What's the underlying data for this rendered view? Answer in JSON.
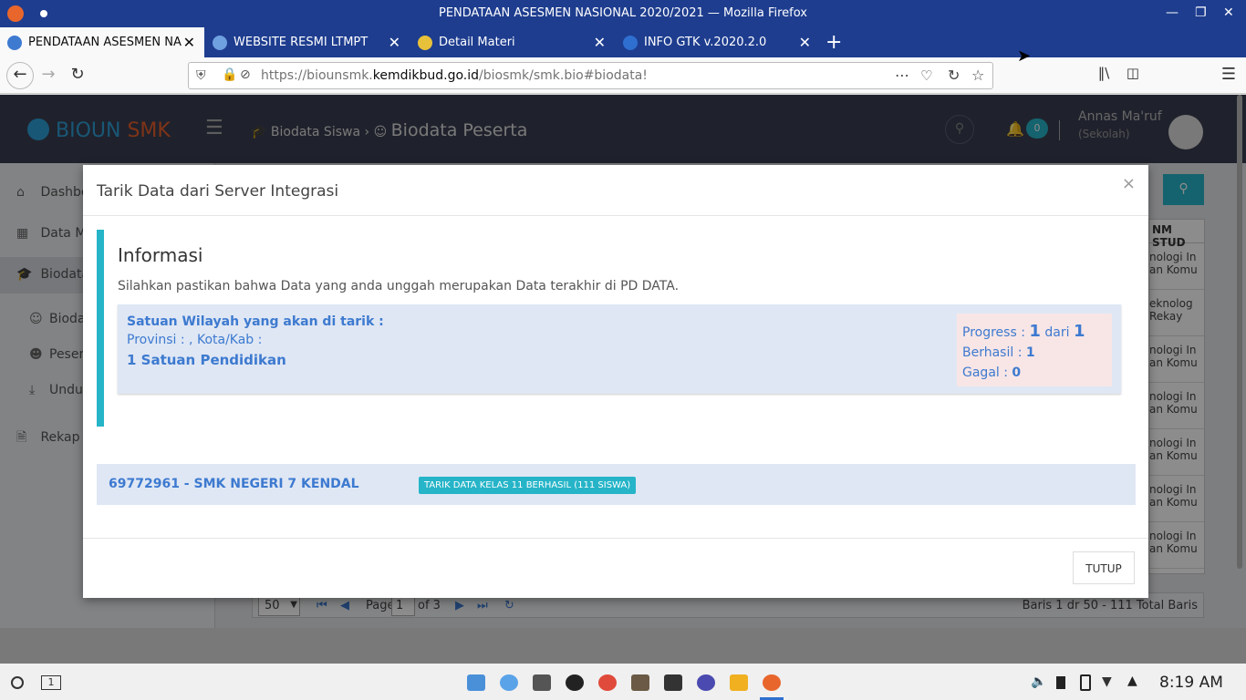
{
  "window": {
    "title": "PENDATAAN ASESMEN NASIONAL 2020/2021 — Mozilla Firefox"
  },
  "tabs": [
    {
      "label": "PENDATAAN ASESMEN NA",
      "active": true
    },
    {
      "label": "WEBSITE RESMI LTMPT",
      "active": false
    },
    {
      "label": "Detail Materi",
      "active": false
    },
    {
      "label": "INFO GTK v.2020.2.0",
      "active": false
    }
  ],
  "nav": {
    "url_prefix": "https://biounsmk.",
    "url_domain": "kemdikbud.go.id",
    "url_path": "/biosmk/smk.bio#biodata!"
  },
  "app": {
    "logo_bioun": "BIOUN",
    "logo_smk": "SMK",
    "crumb_section": "Biodata Siswa",
    "crumb_page": "Biodata Peserta",
    "notif_count": "0",
    "user_name": "Annas Ma'ruf",
    "user_role": "(Sekolah)"
  },
  "sidebar": {
    "items": [
      {
        "label": "Dashbo",
        "icon": "home-icon"
      },
      {
        "label": "Data M",
        "icon": "grid-icon"
      },
      {
        "label": "Biodata",
        "icon": "graduation-cap-icon"
      },
      {
        "label": "Bioda",
        "icon": "user-icon"
      },
      {
        "label": "Peser",
        "icon": "user-outline-icon"
      },
      {
        "label": "Undu",
        "icon": "download-icon"
      },
      {
        "label": "Rekap",
        "icon": "document-icon"
      }
    ]
  },
  "table_bg": {
    "col_header": "NM STUD",
    "cells": [
      [
        "nologi In",
        "an Komu"
      ],
      [
        "eknolog",
        "Rekay"
      ],
      [
        "nologi In",
        "an Komu"
      ],
      [
        "nologi In",
        "an Komu"
      ],
      [
        "nologi In",
        "an Komu"
      ],
      [
        "nologi In",
        "an Komu"
      ],
      [
        "nologi In",
        "an Komu"
      ]
    ]
  },
  "pager": {
    "page_size": "50",
    "page_label": "Page",
    "page_value": "1",
    "of_label": "of 3",
    "summary": "Baris 1 dr 50 - 111 Total Baris"
  },
  "modal": {
    "title": "Tarik Data dari Server Integrasi",
    "info_heading": "Informasi",
    "info_text": "Silahkan pastikan bahwa Data yang anda unggah merupakan Data terakhir di PD DATA.",
    "wilayah_heading": "Satuan Wilayah yang akan di tarik :",
    "wilayah_prov": "Provinsi : , Kota/Kab :",
    "wilayah_satuan": "1 Satuan Pendidikan",
    "progress_label": "Progress :",
    "progress_done": "1",
    "progress_of": "dari",
    "progress_total": "1",
    "berhasil_label": "Berhasil :",
    "berhasil_value": "1",
    "gagal_label": "Gagal :",
    "gagal_value": "0",
    "school": "69772961 - SMK NEGERI 7 KENDAL",
    "school_status": "TARIK DATA KELAS 11 BERHASIL (111 SISWA)",
    "close_button": "TUTUP"
  },
  "taskbar": {
    "workspace": "1",
    "clock": "8:19 AM"
  },
  "colors": {
    "titlebar": "#1e3d8f",
    "app_header": "#3a3f51",
    "accent": "#26b4c8",
    "link_blue": "#3d7ad0"
  }
}
